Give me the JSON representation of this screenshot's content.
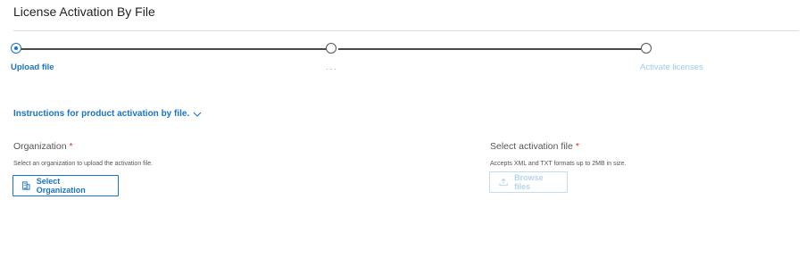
{
  "page": {
    "title": "License Activation By File"
  },
  "stepper": {
    "steps": [
      {
        "label": "Upload file",
        "state": "active"
      },
      {
        "label": "...",
        "state": "pending"
      },
      {
        "label": "Activate licenses",
        "state": "disabled"
      }
    ]
  },
  "instructions": {
    "label": "Instructions for product activation by file.",
    "icon": "chevron-down-icon"
  },
  "organization": {
    "label": "Organization",
    "required_mark": "*",
    "help": "Select an organization to upload the activation file.",
    "button_label": "Select Organization",
    "button_icon": "building-icon"
  },
  "activation_file": {
    "label": "Select activation file",
    "required_mark": "*",
    "help": "Accepts XML and TXT formats up to 2MB in size.",
    "button_label": "Browse files",
    "button_icon": "upload-icon",
    "button_disabled": true
  },
  "colors": {
    "primary": "#1a73c8",
    "disabled": "#b5d4ee",
    "required": "#d0312d"
  }
}
